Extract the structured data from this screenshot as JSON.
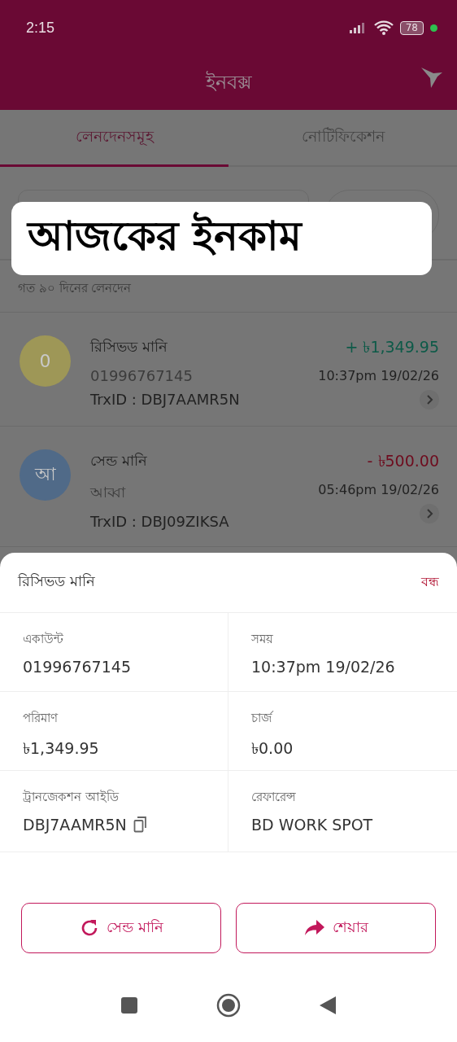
{
  "status_bar": {
    "time": "2:15",
    "battery": "78"
  },
  "header": {
    "title": "ইনবক্স"
  },
  "tabs": [
    {
      "label": "লেনদেনসমূহ",
      "selected": true
    },
    {
      "label": "নোটিফিকেশন",
      "selected": false
    }
  ],
  "overlay_caption": "আজকের ইনকাম",
  "list_caption": "গত ৯০ দিনের লেনদেন",
  "transactions": [
    {
      "avatar": "0",
      "color": "#9e9757",
      "title": "রিসিভড মানি",
      "party": "01996767145",
      "amount": "+ ৳1,349.95",
      "kind": "in",
      "time": "10:37pm 19/02/26",
      "trx_id": "TrxID : DBJ7AAMR5N"
    },
    {
      "avatar": "আ",
      "color": "#506a88",
      "title": "সেন্ড মানি",
      "party": "আব্বা",
      "amount": "- ৳500.00",
      "kind": "out",
      "time": "05:46pm 19/02/26",
      "trx_id": "TrxID : DBJ09ZIKSA"
    }
  ],
  "sheet": {
    "title": "রিসিভড মানি",
    "close": "বন্ধ",
    "fields": [
      {
        "label": "একাউন্ট",
        "value": "01996767145",
        "copyable": false
      },
      {
        "label": "সময়",
        "value": "10:37pm 19/02/26",
        "copyable": false
      },
      {
        "label": "পরিমাণ",
        "value": "৳1,349.95",
        "copyable": false
      },
      {
        "label": "চার্জ",
        "value": "৳0.00",
        "copyable": false
      },
      {
        "label": "ট্রানজেকশন আইডি",
        "value": "DBJ7AAMR5N",
        "copyable": true
      },
      {
        "label": "রেফারেন্স",
        "value": "BD WORK SPOT",
        "copyable": false
      }
    ],
    "buttons": [
      {
        "label": "সেন্ড মানি",
        "kind": "repeat"
      },
      {
        "label": "শেয়ার",
        "kind": "share"
      }
    ]
  }
}
